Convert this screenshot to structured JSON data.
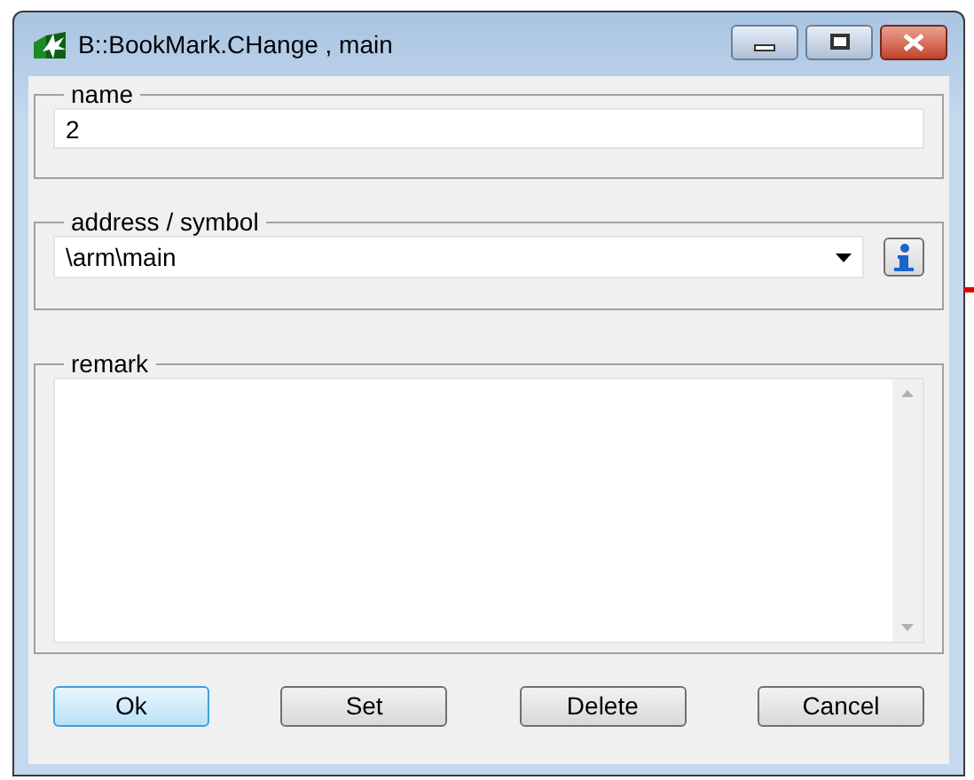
{
  "window": {
    "title": "B::BookMark.CHange , main"
  },
  "name": {
    "label": "name",
    "value": "2"
  },
  "address": {
    "label": "address / symbol",
    "value": "\\arm\\main"
  },
  "remark": {
    "label": "remark"
  },
  "buttons": [
    {
      "label": "Ok",
      "default": true
    },
    {
      "label": "Set",
      "default": false
    },
    {
      "label": "Delete",
      "default": false
    },
    {
      "label": "Cancel",
      "default": false
    }
  ]
}
